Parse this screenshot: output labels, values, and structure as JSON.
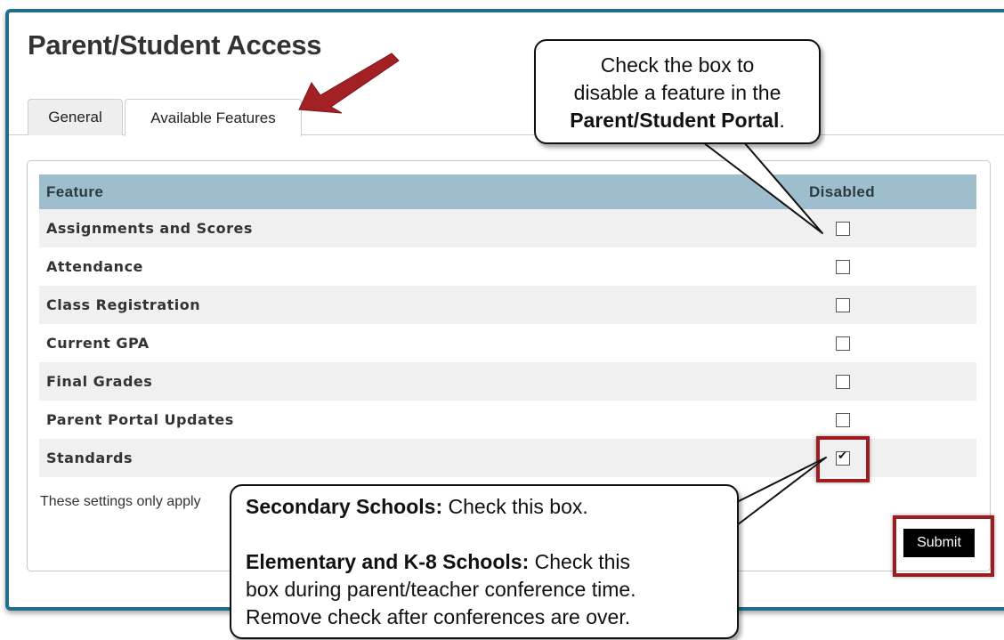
{
  "page": {
    "title": "Parent/Student Access"
  },
  "tabs": [
    {
      "label": "General"
    },
    {
      "label": "Available Features"
    }
  ],
  "table": {
    "headers": {
      "feature": "Feature",
      "disabled": "Disabled"
    },
    "rows": [
      {
        "feature": "Assignments and Scores",
        "disabled": false
      },
      {
        "feature": "Attendance",
        "disabled": false
      },
      {
        "feature": "Class Registration",
        "disabled": false
      },
      {
        "feature": "Current GPA",
        "disabled": false
      },
      {
        "feature": "Final Grades",
        "disabled": false
      },
      {
        "feature": "Parent Portal Updates",
        "disabled": false
      },
      {
        "feature": "Standards",
        "disabled": true
      }
    ]
  },
  "footnote": "These settings only apply",
  "submit_label": "Submit",
  "callout_top": {
    "line1": "Check the box to",
    "line2": "disable a feature in the",
    "line3_bold": "Parent/Student Portal",
    "line3_end": "."
  },
  "callout_bottom": {
    "secondary_bold": "Secondary Schools:",
    "secondary_text": " Check this box.",
    "elementary_bold": "Elementary and K-8 Schools:",
    "elementary_text1": " Check this",
    "elementary_text2": "box during parent/teacher conference time.",
    "elementary_text3": "Remove check after conferences are over."
  },
  "colors": {
    "frame": "#1f6f8b",
    "header_bg": "#9fbecd",
    "highlight": "#9b1d20",
    "arrow": "#a32125"
  }
}
